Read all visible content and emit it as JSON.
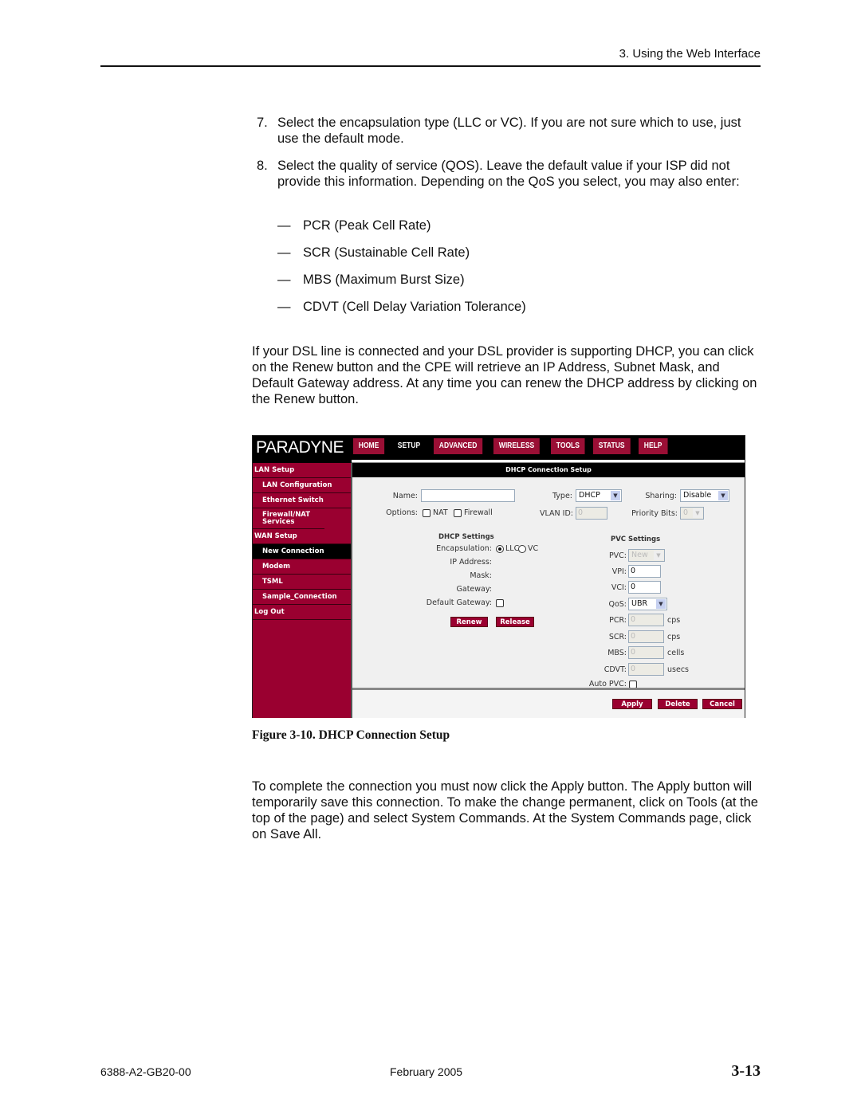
{
  "header": {
    "running_head": "3. Using the Web Interface"
  },
  "steps": [
    {
      "num": "7.",
      "text": "Select the encapsulation type (LLC or VC). If you are not sure which to use, just use the default mode."
    },
    {
      "num": "8.",
      "text": "Select the quality of service (QOS). Leave the default value if your ISP did not provide this information.  Depending on the QoS you select, you may also enter:"
    }
  ],
  "qos_params": [
    {
      "dash": "—",
      "text": "PCR (Peak Cell Rate)"
    },
    {
      "dash": "—",
      "text": "SCR (Sustainable Cell Rate)"
    },
    {
      "dash": "—",
      "text": "MBS (Maximum Burst Size)"
    },
    {
      "dash": "—",
      "text": "CDVT (Cell Delay Variation Tolerance)"
    }
  ],
  "dhcp_paragraph": "If your DSL line is connected and your DSL provider is supporting DHCP, you can click on the Renew button and the CPE will retrieve an IP Address, Subnet Mask, and Default Gateway address. At any time you can renew the DHCP address by clicking on the Renew button.",
  "screenshot": {
    "logo": "PARADYNE",
    "nav_tabs": [
      {
        "label": "HOME",
        "active": false
      },
      {
        "label": "SETUP",
        "active": true
      },
      {
        "label": "ADVANCED",
        "active": false
      },
      {
        "label": "WIRELESS",
        "active": false
      },
      {
        "label": "TOOLS",
        "active": false
      },
      {
        "label": "STATUS",
        "active": false
      },
      {
        "label": "HELP",
        "active": false
      }
    ],
    "sidebar": [
      {
        "label": "LAN Setup",
        "sub": false
      },
      {
        "label": "LAN Configuration",
        "sub": true
      },
      {
        "label": "Ethernet Switch",
        "sub": true
      },
      {
        "label": "Firewall/NAT Services",
        "sub": true
      },
      {
        "label": "WAN Setup",
        "sub": false
      },
      {
        "label": "New Connection",
        "sub": true,
        "active": true
      },
      {
        "label": "Modem",
        "sub": true
      },
      {
        "label": "TSML",
        "sub": true
      },
      {
        "label": "Sample_Connection",
        "sub": true
      },
      {
        "label": "Log Out",
        "sub": false
      }
    ],
    "title": "DHCP Connection Setup",
    "form": {
      "name_label": "Name:",
      "name_value": "",
      "options_label": "Options:",
      "nat_label": "NAT",
      "nat_checked": false,
      "firewall_label": "Firewall",
      "firewall_checked": false,
      "type_label": "Type:",
      "type_value": "DHCP",
      "sharing_label": "Sharing:",
      "sharing_value": "Disable",
      "vlan_label": "VLAN ID:",
      "vlan_value": "0",
      "priority_label": "Priority Bits:",
      "priority_value": "0"
    },
    "dhcp_settings": {
      "heading": "DHCP Settings",
      "encapsulation_label": "Encapsulation:",
      "llc_label": "LLC",
      "vc_label": "VC",
      "selected": "LLC",
      "ip_label": "IP Address:",
      "mask_label": "Mask:",
      "gateway_label": "Gateway:",
      "default_gateway_label": "Default Gateway:",
      "default_gateway_checked": false,
      "renew_label": "Renew",
      "release_label": "Release"
    },
    "pvc_settings": {
      "heading": "PVC Settings",
      "pvc_label": "PVC:",
      "pvc_value": "New",
      "vpi_label": "VPI:",
      "vpi_value": "0",
      "vci_label": "VCI:",
      "vci_value": "0",
      "qos_label": "QoS:",
      "qos_value": "UBR",
      "pcr_label": "PCR:",
      "pcr_value": "0",
      "pcr_unit": "cps",
      "scr_label": "SCR:",
      "scr_value": "0",
      "scr_unit": "cps",
      "mbs_label": "MBS:",
      "mbs_value": "0",
      "mbs_unit": "cells",
      "cdvt_label": "CDVT:",
      "cdvt_value": "0",
      "cdvt_unit": "usecs",
      "auto_pvc_label": "Auto PVC:",
      "auto_pvc_checked": false
    },
    "footer_buttons": {
      "apply": "Apply",
      "delete": "Delete",
      "cancel": "Cancel"
    },
    "colors": {
      "brand": "#9a0030",
      "nav_bar": "#000000"
    }
  },
  "caption": "Figure 3-10.   DHCP Connection Setup",
  "closing_paragraph": "To complete the connection you must now click the Apply button. The Apply button will temporarily save this connection. To make the change permanent, click on Tools (at the top of the page) and select System Commands. At the System Commands page, click on Save All.",
  "footer": {
    "doc_number": "6388-A2-GB20-00",
    "date": "February 2005",
    "page": "3-13"
  }
}
